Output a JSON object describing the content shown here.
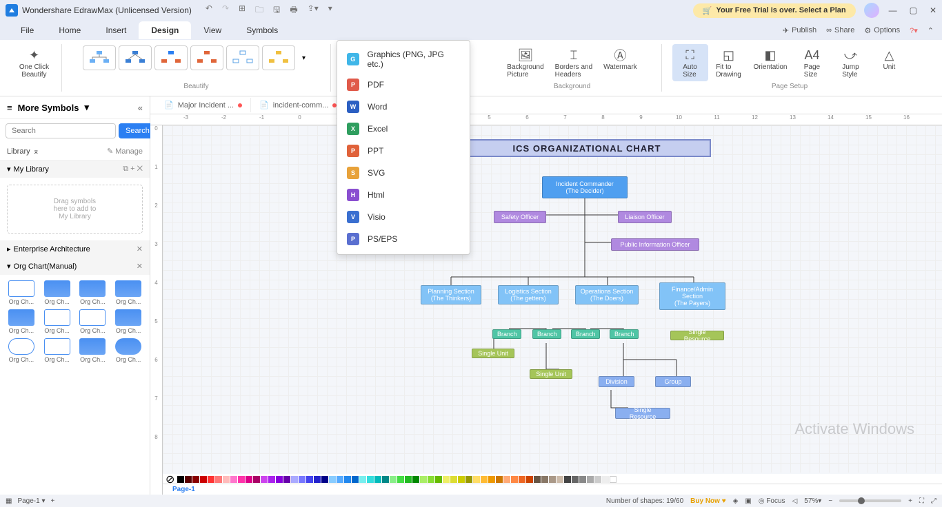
{
  "app": {
    "title": "Wondershare EdrawMax (Unlicensed Version)"
  },
  "trial": {
    "text": "Your Free Trial is over. Select a Plan"
  },
  "menubar": {
    "tabs": [
      "File",
      "Home",
      "Insert",
      "Design",
      "View",
      "Symbols"
    ],
    "active": 3,
    "right": {
      "publish": "Publish",
      "share": "Share",
      "options": "Options"
    }
  },
  "ribbon": {
    "beautify": {
      "btn": "One Click\nBeautify",
      "section": "Beautify"
    },
    "background": {
      "bgpic": "Background\nPicture",
      "borders": "Borders and\nHeaders",
      "watermark": "Watermark",
      "section": "Background"
    },
    "pagesetup": {
      "autosize": "Auto\nSize",
      "fit": "Fit to\nDrawing",
      "orient": "Orientation",
      "pagesize": "Page\nSize",
      "jump": "Jump\nStyle",
      "unit": "Unit",
      "section": "Page Setup"
    }
  },
  "export_menu": [
    {
      "label": "Graphics (PNG, JPG etc.)",
      "color": "#3fb6e8",
      "abbr": "G"
    },
    {
      "label": "PDF",
      "color": "#e05a4a",
      "abbr": "P"
    },
    {
      "label": "Word",
      "color": "#2b5fc2",
      "abbr": "W"
    },
    {
      "label": "Excel",
      "color": "#2f9e5f",
      "abbr": "X"
    },
    {
      "label": "PPT",
      "color": "#e0623a",
      "abbr": "P"
    },
    {
      "label": "SVG",
      "color": "#e8a23a",
      "abbr": "S"
    },
    {
      "label": "Html",
      "color": "#8a4fd0",
      "abbr": "H"
    },
    {
      "label": "Visio",
      "color": "#3a6fd0",
      "abbr": "V"
    },
    {
      "label": "PS/EPS",
      "color": "#5a6fd0",
      "abbr": "P"
    }
  ],
  "leftpanel": {
    "head": "More Symbols",
    "search_placeholder": "Search",
    "search_btn": "Search",
    "library": "Library",
    "manage": "Manage",
    "mylib": "My Library",
    "drop": "Drag symbols\nhere to add to\nMy Library",
    "ent": "Enterprise Architecture",
    "org": "Org Chart(Manual)",
    "shape_label": "Org Ch..."
  },
  "doctabs": {
    "t1": "Major Incident ...",
    "t2": "incident-comm..."
  },
  "chart": {
    "title": "ICS ORGANIZATIONAL CHART",
    "commander": {
      "l1": "Incident Commander",
      "l2": "(The Decider)"
    },
    "safety": "Safety Officer",
    "liaison": "Liaison Officer",
    "pio": "Public Information Officer",
    "planning": {
      "l1": "Planning Section",
      "l2": "(The Thinkers)"
    },
    "logistics": {
      "l1": "Logistics Section",
      "l2": "(The getters)"
    },
    "ops": {
      "l1": "Operations Section",
      "l2": "(The Doers)"
    },
    "finance": {
      "l1": "Finance/Admin\nSection",
      "l2": "(The Payers)"
    },
    "branch": "Branch",
    "single_unit": "Single Unit",
    "single_resource": "Single Resource",
    "division": "Division",
    "group": "Group"
  },
  "status": {
    "page": "Page-1",
    "shapes": "Number of shapes: 19/60",
    "buy": "Buy Now",
    "focus": "Focus",
    "zoom": "57%"
  },
  "watermark": "Activate Windows"
}
